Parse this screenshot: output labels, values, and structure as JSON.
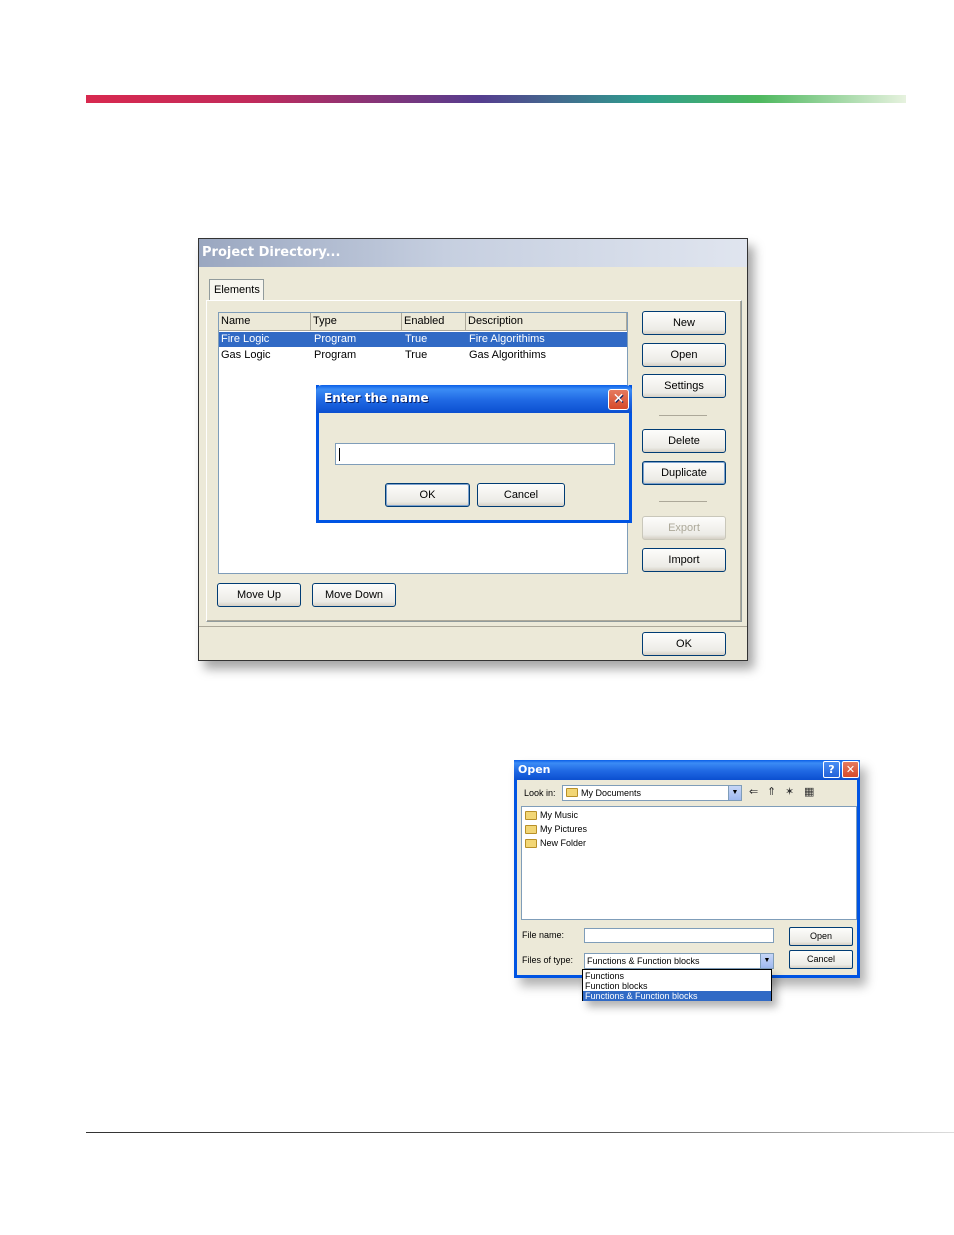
{
  "project_directory": {
    "title": "Project Directory...",
    "tab_label": "Elements",
    "columns": [
      "Name",
      "Type",
      "Enabled",
      "Description"
    ],
    "rows": [
      {
        "name": "Fire Logic",
        "type": "Program",
        "enabled": "True",
        "description": "Fire Algorithims",
        "selected": true
      },
      {
        "name": "Gas Logic",
        "type": "Program",
        "enabled": "True",
        "description": "Gas Algorithims",
        "selected": false
      }
    ],
    "buttons": {
      "new": "New",
      "open": "Open",
      "settings": "Settings",
      "delete": "Delete",
      "duplicate": "Duplicate",
      "export": "Export",
      "import": "Import",
      "move_up": "Move Up",
      "move_down": "Move Down",
      "ok": "OK"
    }
  },
  "name_dialog": {
    "title": "Enter the name",
    "input_value": "",
    "ok_label": "OK",
    "cancel_label": "Cancel"
  },
  "open_dialog": {
    "title": "Open",
    "help_button": "?",
    "close_button": "✕",
    "look_in_label": "Look in:",
    "look_in_value": "My Documents",
    "items": [
      "My Music",
      "My Pictures",
      "New Folder"
    ],
    "file_name_label": "File name:",
    "file_name_value": "",
    "files_of_type_label": "Files of type:",
    "files_of_type_value": "Functions & Function blocks",
    "open_label": "Open",
    "cancel_label": "Cancel",
    "type_options": [
      "Functions",
      "Function blocks",
      "Functions & Function blocks"
    ],
    "selected_type_index": 2
  },
  "icons": {
    "close": "✕",
    "combo_arrow": "▼",
    "back": "⇐",
    "up_folder": "⇑",
    "new_folder": "✶",
    "view_menu": "▦"
  },
  "colors": {
    "selection": "#316ac5",
    "xp_blue": "#0054e3",
    "dialog_bg": "#ece9d8"
  }
}
